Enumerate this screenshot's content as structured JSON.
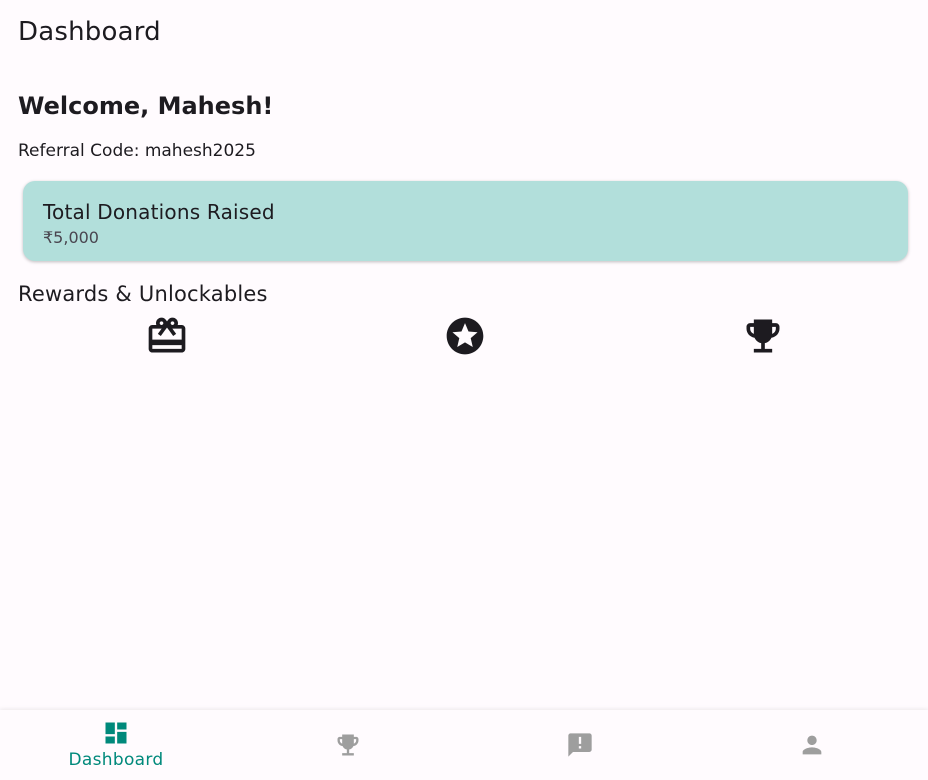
{
  "app_bar": {
    "title": "Dashboard"
  },
  "welcome": {
    "text": "Welcome, Mahesh!"
  },
  "referral": {
    "text": "Referral Code: mahesh2025"
  },
  "donation_card": {
    "title": "Total Donations Raised",
    "amount": "₹5,000",
    "background_color": "#b2dfdb"
  },
  "rewards": {
    "title": "Rewards & Unlockables",
    "items": [
      {
        "icon": "gift-card-icon"
      },
      {
        "icon": "star-badge-icon"
      },
      {
        "icon": "trophy-icon"
      }
    ]
  },
  "bottom_nav": {
    "active_color": "#00897b",
    "inactive_color": "#9e9e9e",
    "items": [
      {
        "icon": "dashboard-icon",
        "label": "Dashboard",
        "active": true
      },
      {
        "icon": "trophy-icon",
        "active": false
      },
      {
        "icon": "announcement-icon",
        "active": false
      },
      {
        "icon": "person-icon",
        "active": false
      }
    ]
  }
}
